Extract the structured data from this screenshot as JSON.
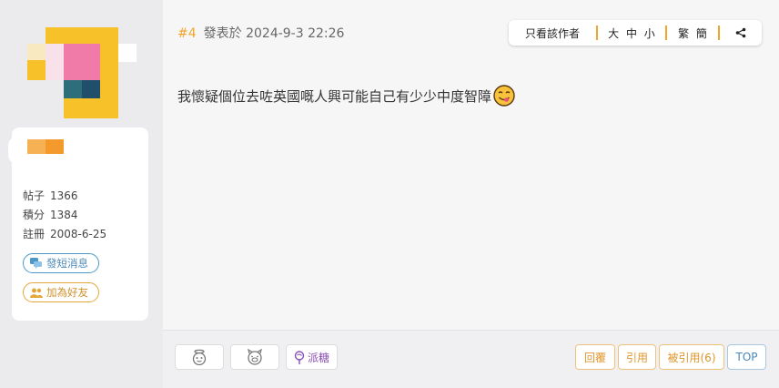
{
  "user": {
    "stats": [
      {
        "label": "帖子",
        "value": "1366"
      },
      {
        "label": "積分",
        "value": "1384"
      },
      {
        "label": "註冊",
        "value": "2008-6-25"
      }
    ],
    "message_button": "發短消息",
    "add_friend_button": "加為好友"
  },
  "post": {
    "number": "#4",
    "posted_label": "發表於",
    "timestamp": "2024-9-3 22:26",
    "body": "我懷疑個位去咗英國嘅人興可能自己有少少中度智障",
    "emoji": "yum-face-icon"
  },
  "toolbar": {
    "author_only": "只看該作者",
    "font_sizes": "大 中 小",
    "script": "繁 簡",
    "share_icon": "share-icon"
  },
  "footer": {
    "candy_label": "派糖",
    "reply_label": "回覆",
    "quote_label": "引用",
    "quoted_label": "被引用(6)",
    "top_label": "TOP"
  },
  "colors": {
    "accent": "#f0a52a",
    "link_blue": "#4a88b9",
    "candy_purple": "#8a4fb3"
  }
}
